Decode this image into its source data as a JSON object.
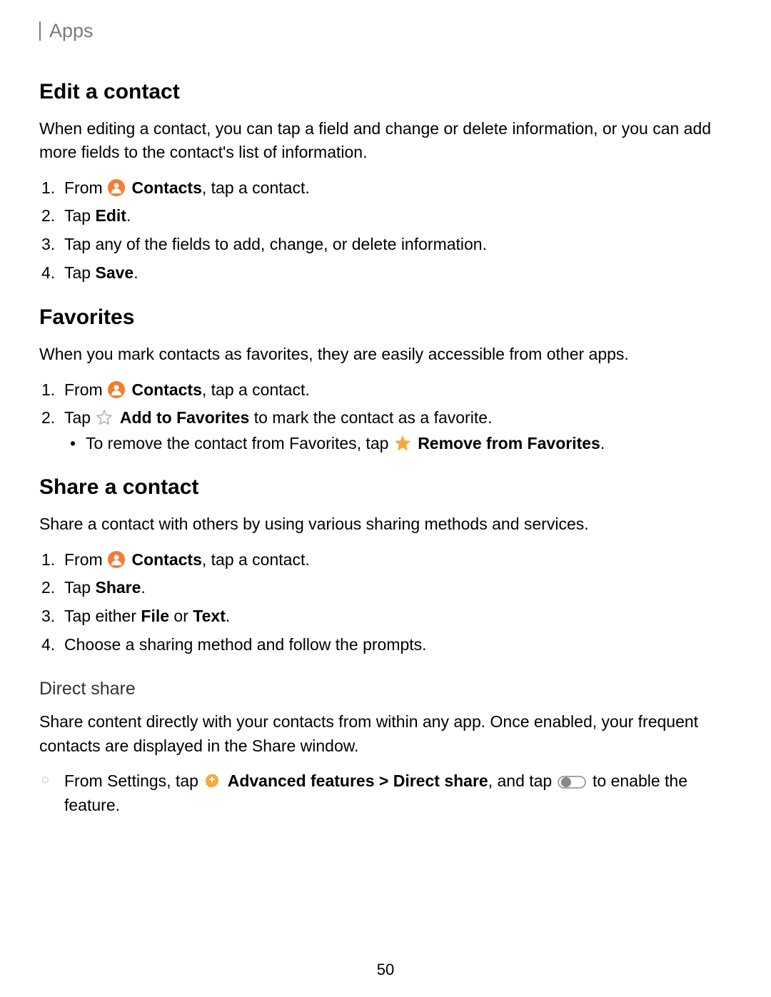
{
  "breadcrumb": "Apps",
  "page_number": "50",
  "sections": {
    "edit_contact": {
      "heading": "Edit a contact",
      "intro": "When editing a contact, you can tap a field and change or delete information, or you can add more fields to the contact's list of information.",
      "step1_from": "From ",
      "step1_contacts": "Contacts",
      "step1_suffix": ", tap a contact.",
      "step2_tap": "Tap ",
      "step2_edit": "Edit",
      "step2_period": ".",
      "step3": "Tap any of the fields to add, change, or delete information.",
      "step4_tap": "Tap ",
      "step4_save": "Save",
      "step4_period": "."
    },
    "favorites": {
      "heading": "Favorites",
      "intro": "When you mark contacts as favorites, they are easily accessible from other apps.",
      "step1_from": "From ",
      "step1_contacts": "Contacts",
      "step1_suffix": ", tap a contact.",
      "step2_tap": "Tap ",
      "step2_addfav": "Add to Favorites",
      "step2_suffix": " to mark the contact as a favorite.",
      "sub_prefix": "To remove the contact from Favorites, tap ",
      "sub_removefav": "Remove from Favorites",
      "sub_period": "."
    },
    "share_contact": {
      "heading": "Share a contact",
      "intro": "Share a contact with others by using various sharing methods and services.",
      "step1_from": "From ",
      "step1_contacts": "Contacts",
      "step1_suffix": ", tap a contact.",
      "step2_tap": "Tap ",
      "step2_share": "Share",
      "step2_period": ".",
      "step3_prefix": "Tap either ",
      "step3_file": "File",
      "step3_or": " or ",
      "step3_text": "Text",
      "step3_period": ".",
      "step4": "Choose a sharing method and follow the prompts."
    },
    "direct_share": {
      "heading": "Direct share",
      "intro": "Share content directly with your contacts from within any app. Once enabled, your frequent contacts are displayed in the Share window.",
      "bullet_from": "From Settings, tap ",
      "bullet_advfeat": "Advanced features",
      "bullet_arrow": " > ",
      "bullet_directshare": "Direct share",
      "bullet_andtap": ", and tap ",
      "bullet_suffix": " to enable the feature."
    }
  }
}
